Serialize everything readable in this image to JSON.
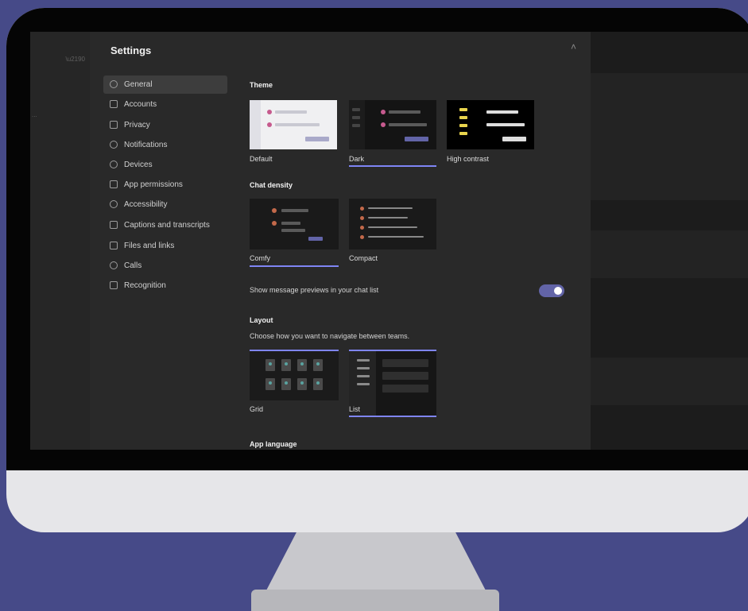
{
  "settings": {
    "title": "Settings",
    "close_glyph": "˄",
    "nav": [
      {
        "label": "General",
        "icon": "gear-icon",
        "selected": true
      },
      {
        "label": "Accounts",
        "icon": "account-icon"
      },
      {
        "label": "Privacy",
        "icon": "lock-icon"
      },
      {
        "label": "Notifications",
        "icon": "bell-icon"
      },
      {
        "label": "Devices",
        "icon": "devices-icon"
      },
      {
        "label": "App permissions",
        "icon": "permissions-icon"
      },
      {
        "label": "Accessibility",
        "icon": "accessibility-icon"
      },
      {
        "label": "Captions and transcripts",
        "icon": "captions-icon"
      },
      {
        "label": "Files and links",
        "icon": "file-icon"
      },
      {
        "label": "Calls",
        "icon": "phone-icon"
      },
      {
        "label": "Recognition",
        "icon": "recognition-icon"
      }
    ],
    "theme": {
      "heading": "Theme",
      "options": [
        {
          "label": "Default",
          "selected": false
        },
        {
          "label": "Dark",
          "selected": true
        },
        {
          "label": "High contrast",
          "selected": false
        }
      ]
    },
    "chat_density": {
      "heading": "Chat density",
      "options": [
        {
          "label": "Comfy",
          "selected": true
        },
        {
          "label": "Compact",
          "selected": false
        }
      ]
    },
    "preview_toggle": {
      "label": "Show message previews in your chat list",
      "on": true
    },
    "layout": {
      "heading": "Layout",
      "description": "Choose how you want to navigate between teams.",
      "options": [
        {
          "label": "Grid",
          "selected": false
        },
        {
          "label": "List",
          "selected": true
        }
      ]
    },
    "next_heading": "App language"
  },
  "colors": {
    "accent": "#7f85f5",
    "toggle": "#6264a7",
    "backdrop": "#464a88"
  }
}
